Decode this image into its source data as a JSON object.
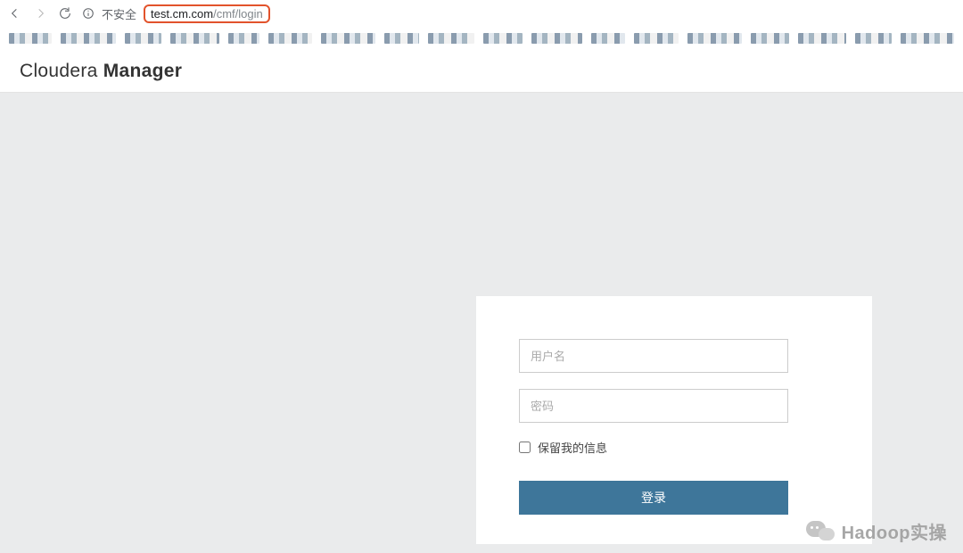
{
  "browser": {
    "insecure_label": "不安全",
    "url_host": "test.cm.com",
    "url_path": "/cmf/login"
  },
  "brand": {
    "prefix": "Cloudera ",
    "strong": "Manager"
  },
  "login": {
    "username_placeholder": "用户名",
    "password_placeholder": "密码",
    "remember_label": "保留我的信息",
    "submit_label": "登录"
  },
  "watermark": {
    "text": "Hadoop实操"
  },
  "bookmarks_widths": [
    56,
    72,
    48,
    64,
    40,
    58,
    70,
    46,
    60,
    52,
    66,
    44,
    58,
    72,
    50,
    62,
    48,
    70
  ]
}
